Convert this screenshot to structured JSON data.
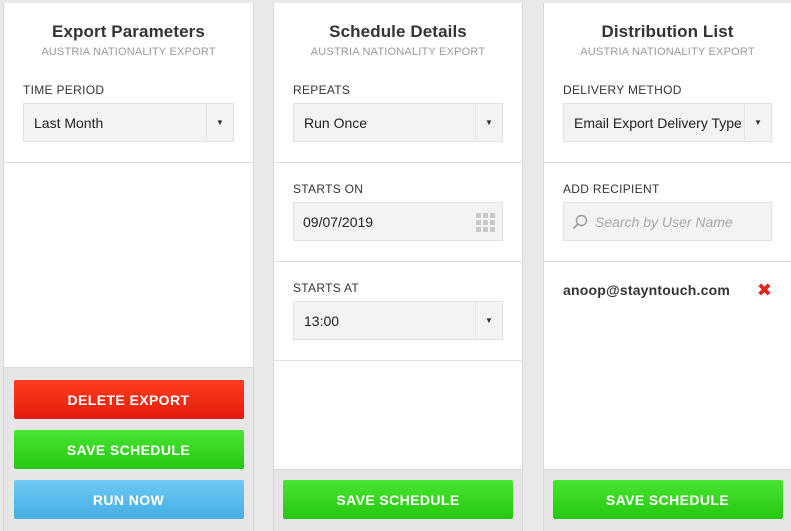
{
  "export_parameters": {
    "title": "Export Parameters",
    "subtitle": "AUSTRIA NATIONALITY EXPORT",
    "time_period_label": "TIME PERIOD",
    "time_period_value": "Last Month",
    "delete_label": "DELETE EXPORT",
    "save_label": "SAVE SCHEDULE",
    "run_label": "RUN NOW"
  },
  "schedule_details": {
    "title": "Schedule Details",
    "subtitle": "AUSTRIA NATIONALITY EXPORT",
    "repeats_label": "REPEATS",
    "repeats_value": "Run Once",
    "starts_on_label": "STARTS ON",
    "starts_on_value": "09/07/2019",
    "starts_at_label": "STARTS AT",
    "starts_at_value": "13:00",
    "save_label": "SAVE SCHEDULE"
  },
  "distribution_list": {
    "title": "Distribution List",
    "subtitle": "AUSTRIA NATIONALITY EXPORT",
    "delivery_method_label": "DELIVERY METHOD",
    "delivery_method_value": "Email Export Delivery Type",
    "add_recipient_label": "ADD RECIPIENT",
    "search_placeholder": "Search by User Name",
    "recipients": [
      "anoop@stayntouch.com"
    ],
    "save_label": "SAVE SCHEDULE"
  },
  "colors": {
    "delete": "#ff3d20",
    "save": "#26c710",
    "run": "#45aee4",
    "remove": "#e3231d"
  }
}
